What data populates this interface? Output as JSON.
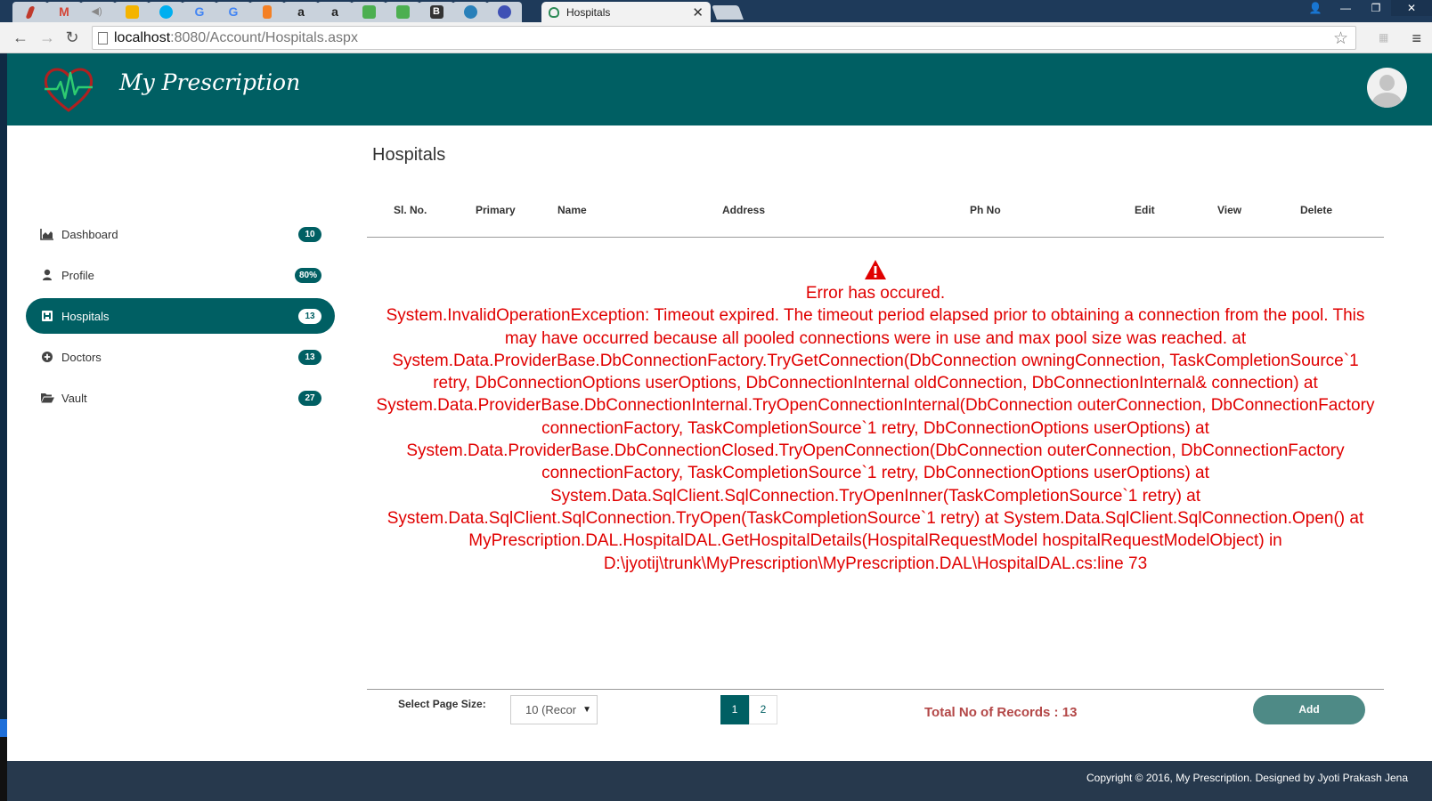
{
  "browser": {
    "tabs": [
      {
        "icon": "pdf-icon",
        "color": "#c0392b"
      },
      {
        "icon": "gmail-icon",
        "color": "#d44638"
      },
      {
        "icon": "audio-icon",
        "color": "#8e8e8e"
      },
      {
        "icon": "maps-icon",
        "color": "#f4b400"
      },
      {
        "icon": "skype-icon",
        "color": "#00aff0"
      },
      {
        "icon": "google-icon",
        "color": "#4285f4"
      },
      {
        "icon": "google-icon",
        "color": "#4285f4"
      },
      {
        "icon": "stackoverflow-icon",
        "color": "#f48024"
      },
      {
        "icon": "amazon-icon",
        "color": "#222222"
      },
      {
        "icon": "amazon-icon",
        "color": "#222222"
      },
      {
        "icon": "chart-icon",
        "color": "#4caf50"
      },
      {
        "icon": "chart-icon",
        "color": "#4caf50"
      },
      {
        "icon": "bootstrap-icon",
        "color": "#333333"
      },
      {
        "icon": "asp-icon",
        "color": "#2980b9"
      },
      {
        "icon": "globe-icon",
        "color": "#3f51b5"
      }
    ],
    "active_tab": {
      "title": "Hospitals",
      "close": "✕"
    },
    "url_host": "localhost",
    "url_path": ":8080/Account/Hospitals.aspx",
    "nav": {
      "back": "←",
      "forward": "→",
      "reload": "↻",
      "star": "☆",
      "menu": "≡"
    },
    "window": {
      "user": "👤",
      "minimize": "—",
      "restore": "❐",
      "close": "✕"
    }
  },
  "header": {
    "app_title": "My Prescription",
    "brand_color": "#005f63"
  },
  "sidebar": {
    "items": [
      {
        "label": "Dashboard",
        "badge": "10",
        "icon": "area-chart-icon"
      },
      {
        "label": "Profile",
        "badge": "80%",
        "icon": "user-icon"
      },
      {
        "label": "Hospitals",
        "badge": "13",
        "icon": "hospital-icon",
        "active": true
      },
      {
        "label": "Doctors",
        "badge": "13",
        "icon": "plus-circle-icon"
      },
      {
        "label": "Vault",
        "badge": "27",
        "icon": "folder-open-icon"
      }
    ]
  },
  "main": {
    "page_title": "Hospitals",
    "columns": [
      "Sl. No.",
      "Primary",
      "Name",
      "Address",
      "Ph No",
      "Edit",
      "View",
      "Delete"
    ],
    "error": {
      "title": "Error has occured.",
      "message": "System.InvalidOperationException: Timeout expired. The timeout period elapsed prior to obtaining a connection from the pool. This may have occurred because all pooled connections were in use and max pool size was reached. at System.Data.ProviderBase.DbConnectionFactory.TryGetConnection(DbConnection owningConnection, TaskCompletionSource`1 retry, DbConnectionOptions userOptions, DbConnectionInternal oldConnection, DbConnectionInternal& connection) at System.Data.ProviderBase.DbConnectionInternal.TryOpenConnectionInternal(DbConnection outerConnection, DbConnectionFactory connectionFactory, TaskCompletionSource`1 retry, DbConnectionOptions userOptions) at System.Data.ProviderBase.DbConnectionClosed.TryOpenConnection(DbConnection outerConnection, DbConnectionFactory connectionFactory, TaskCompletionSource`1 retry, DbConnectionOptions userOptions) at System.Data.SqlClient.SqlConnection.TryOpenInner(TaskCompletionSource`1 retry) at System.Data.SqlClient.SqlConnection.TryOpen(TaskCompletionSource`1 retry) at System.Data.SqlClient.SqlConnection.Open() at MyPrescription.DAL.HospitalDAL.GetHospitalDetails(HospitalRequestModel hospitalRequestModelObject) in D:\\jyotij\\trunk\\MyPrescription\\MyPrescription.DAL\\HospitalDAL.cs:line 73",
      "color": "#e00000"
    },
    "pager": {
      "page_size_label": "Select Page Size:",
      "page_size_value": "10 (Recor",
      "pages": [
        "1",
        "2"
      ],
      "current_page": "1",
      "total_records": "Total No of Records : 13",
      "add_label": "Add"
    }
  },
  "footer": {
    "copyright": "Copyright © 2016, My Prescription. Designed by  Jyoti Prakash Jena"
  }
}
